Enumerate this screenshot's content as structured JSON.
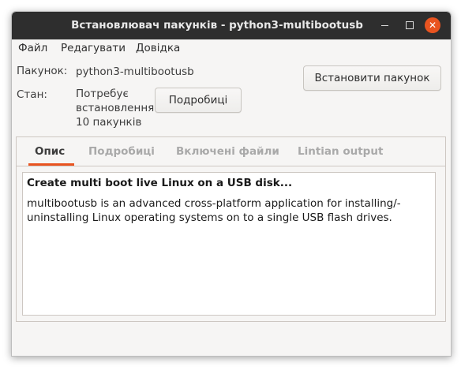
{
  "window": {
    "title": "Встановлювач пакунків - python3-multibootusb",
    "controls": {
      "minimize_icon": "minimize-icon",
      "maximize_icon": "maximize-icon",
      "close_icon": "close-icon",
      "close_color": "#e95420"
    }
  },
  "menu": {
    "items": [
      "Файл",
      "Редагувати",
      "Довідка"
    ]
  },
  "package": {
    "label": "Пакунок:",
    "value": "python3-multibootusb"
  },
  "status": {
    "label": "Стан:",
    "line1": "Потребує",
    "line2": "встановлення",
    "line3": "10 пакунків"
  },
  "buttons": {
    "details": "Подробиці",
    "install": "Встановити пакунок"
  },
  "tabs": {
    "items": [
      "Опис",
      "Подробиці",
      "Включені файли",
      "Lintian output"
    ],
    "active_index": 0,
    "accent_color": "#e95420"
  },
  "description": {
    "heading": "Create multi boot live Linux on a USB disk...",
    "body_line1": "multibootusb is an advanced cross-platform application for installing/-",
    "body_line2": "uninstalling Linux operating systems on to a single USB flash drives."
  }
}
